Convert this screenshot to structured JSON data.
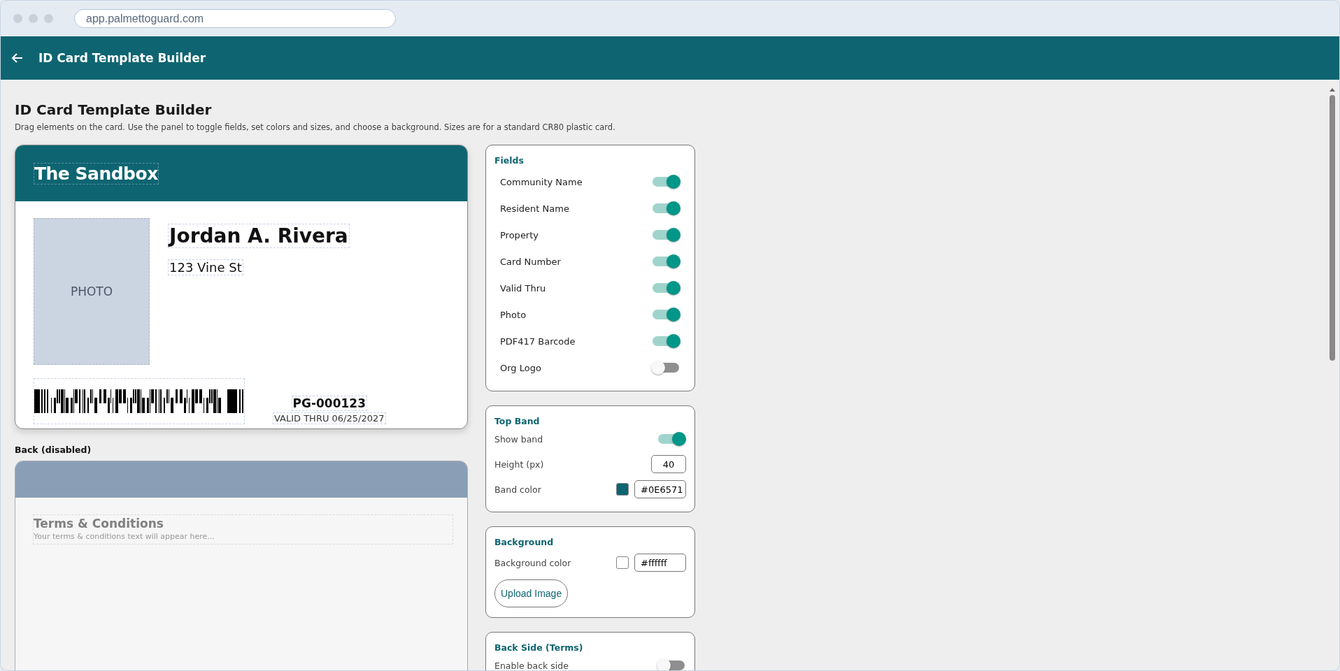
{
  "browser": {
    "url": "app.palmettoguard.com"
  },
  "header": {
    "title": "ID Card Template Builder"
  },
  "page": {
    "title": "ID Card Template Builder",
    "subtitle": "Drag elements on the card. Use the panel to toggle fields, set colors and sizes, and choose a background. Sizes are for a standard CR80 plastic card."
  },
  "card_front": {
    "community_name": "The Sandbox",
    "photo_label": "PHOTO",
    "resident_name": "Jordan A. Rivera",
    "property": "123 Vine St",
    "card_number": "PG-000123",
    "valid_thru": "VALID THRU 06/25/2027"
  },
  "card_back": {
    "label": "Back (disabled)",
    "terms_title": "Terms & Conditions",
    "terms_placeholder": "Your terms & conditions text will appear here..."
  },
  "fields_panel": {
    "title": "Fields",
    "items": [
      {
        "label": "Community Name",
        "on": true
      },
      {
        "label": "Resident Name",
        "on": true
      },
      {
        "label": "Property",
        "on": true
      },
      {
        "label": "Card Number",
        "on": true
      },
      {
        "label": "Valid Thru",
        "on": true
      },
      {
        "label": "Photo",
        "on": true
      },
      {
        "label": "PDF417 Barcode",
        "on": true
      },
      {
        "label": "Org Logo",
        "on": false
      }
    ]
  },
  "top_band_panel": {
    "title": "Top Band",
    "show_band": {
      "label": "Show band",
      "on": true
    },
    "height": {
      "label": "Height (px)",
      "value": "40"
    },
    "band_color": {
      "label": "Band color",
      "value": "#0E6571"
    }
  },
  "background_panel": {
    "title": "Background",
    "color": {
      "label": "Background color",
      "value": "#ffffff"
    },
    "upload_button": "Upload Image"
  },
  "back_side_panel": {
    "title": "Back Side (Terms)",
    "enable": {
      "label": "Enable back side",
      "on": false
    }
  }
}
